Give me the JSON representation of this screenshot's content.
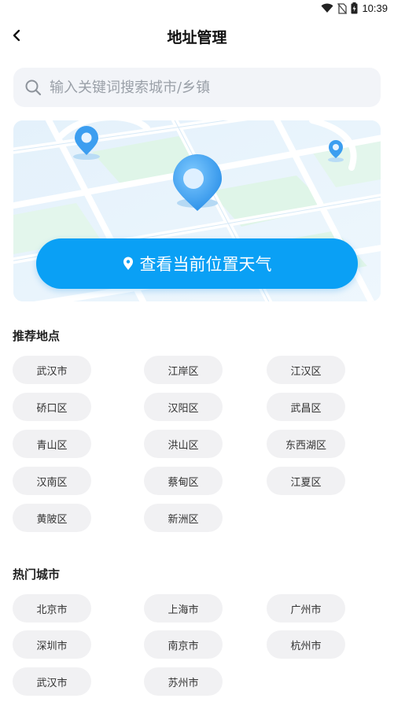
{
  "status_bar": {
    "time": "10:39",
    "icons": [
      "wifi-icon",
      "no-sim-icon",
      "battery-icon"
    ]
  },
  "header": {
    "title": "地址管理",
    "back_icon": "chevron-left-icon"
  },
  "search": {
    "placeholder": "输入关键词搜索城市/乡镇",
    "value": "",
    "icon": "search-icon"
  },
  "map_card": {
    "button_label": "查看当前位置天气",
    "button_icon": "location-pin-icon"
  },
  "recommended": {
    "title": "推荐地点",
    "items": [
      "武汉市",
      "江岸区",
      "江汉区",
      "硚口区",
      "汉阳区",
      "武昌区",
      "青山区",
      "洪山区",
      "东西湖区",
      "汉南区",
      "蔡甸区",
      "江夏区",
      "黄陂区",
      "新洲区"
    ]
  },
  "hot_cities": {
    "title": "热门城市",
    "items": [
      "北京市",
      "上海市",
      "广州市",
      "深圳市",
      "南京市",
      "杭州市",
      "武汉市",
      "苏州市"
    ]
  },
  "colors": {
    "accent": "#0aa0f5",
    "chip_bg": "#f1f1f3",
    "search_bg": "#f2f4f8"
  }
}
